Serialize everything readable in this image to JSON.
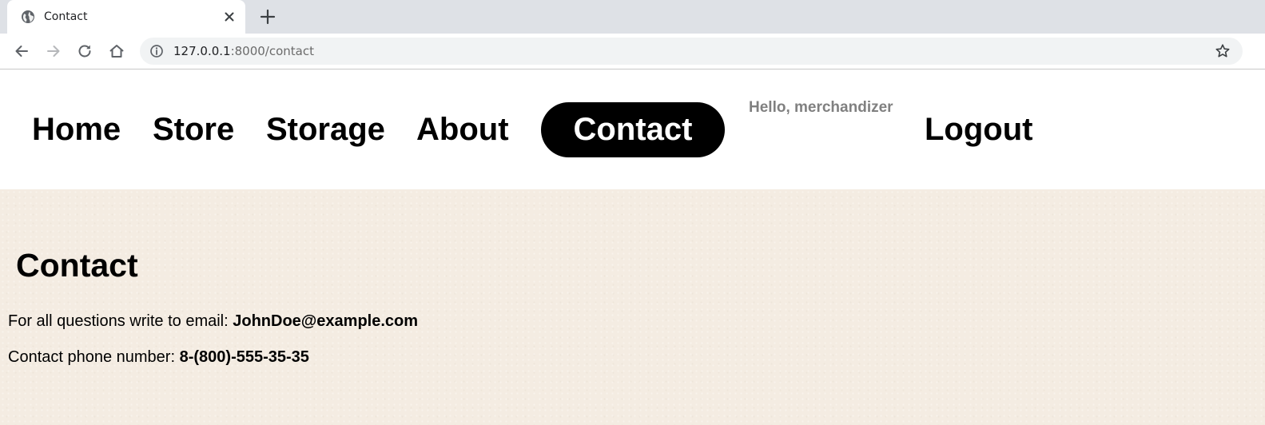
{
  "browser": {
    "tab": {
      "title": "Contact",
      "favicon_icon": "globe-icon",
      "close_icon": "close-icon"
    },
    "new_tab_icon": "plus-icon",
    "toolbar": {
      "back_icon": "arrow-left-icon",
      "forward_icon": "arrow-right-icon",
      "reload_icon": "reload-icon",
      "home_icon": "home-icon"
    },
    "address_bar": {
      "info_icon": "info-icon",
      "url_host": "127.0.0.1",
      "url_path": ":8000/contact",
      "bookmark_icon": "star-icon"
    }
  },
  "nav": {
    "links": [
      {
        "label": "Home"
      },
      {
        "label": "Store"
      },
      {
        "label": "Storage"
      },
      {
        "label": "About"
      },
      {
        "label": "Contact",
        "active": true
      },
      {
        "label": "Logout"
      }
    ],
    "greeting": "Hello, merchandizer"
  },
  "content": {
    "heading": "Contact",
    "email_prefix": "For all questions write to email: ",
    "email": "JohnDoe@example.com",
    "phone_prefix": "Contact phone number: ",
    "phone": "8-(800)-555-35-35"
  },
  "colors": {
    "tabstrip_bg": "#dee1e6",
    "omnibox_bg": "#f1f3f4",
    "content_bg": "#f4ece2",
    "active_nav_bg": "#000000",
    "greeting_text": "#808080"
  }
}
